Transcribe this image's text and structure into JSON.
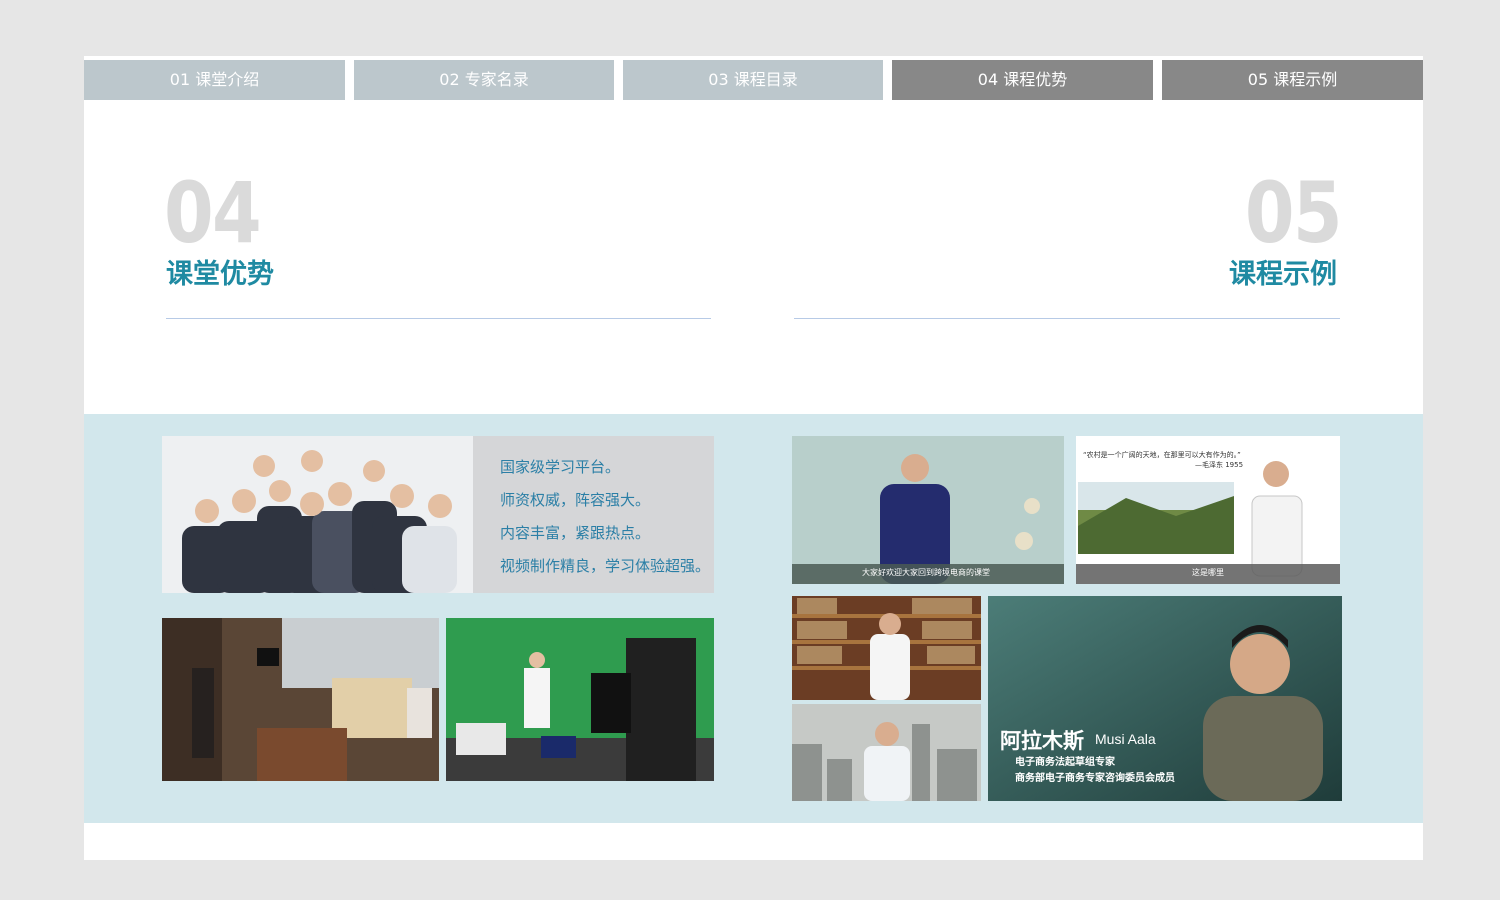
{
  "tabs": [
    {
      "label": "01 课堂介绍"
    },
    {
      "label": "02 专家名录"
    },
    {
      "label": "03 课程目录"
    },
    {
      "label": "04 课程优势"
    },
    {
      "label": "05 课程示例"
    }
  ],
  "sections": {
    "left": {
      "number": "04",
      "title": "课堂优势"
    },
    "right": {
      "number": "05",
      "title": "课程示例"
    }
  },
  "advantages": [
    "国家级学习平台。",
    "师资权威，阵容强大。",
    "内容丰富，紧跟热点。",
    "视频制作精良，学习体验超强。"
  ],
  "examples": {
    "video1_caption": "大家好欢迎大家回到跨境电商的课堂",
    "video2_quote": "“农村是一个广阔的天地，在那里可以大有作为的。”",
    "video2_quote_attr": "—毛泽东 1955",
    "video2_caption": "这是哪里",
    "featured_name_cn": "阿拉木斯",
    "featured_name_en": "Musi Aala",
    "featured_title_1": "电子商务法起草组专家",
    "featured_title_2": "商务部电子商务专家咨询委员会成员"
  },
  "colors": {
    "tab_light": "#bcc7cc",
    "tab_dark": "#888888",
    "accent": "#1f8aa2",
    "band": "#d2e7ec",
    "text_blue": "#2b7fa6"
  }
}
